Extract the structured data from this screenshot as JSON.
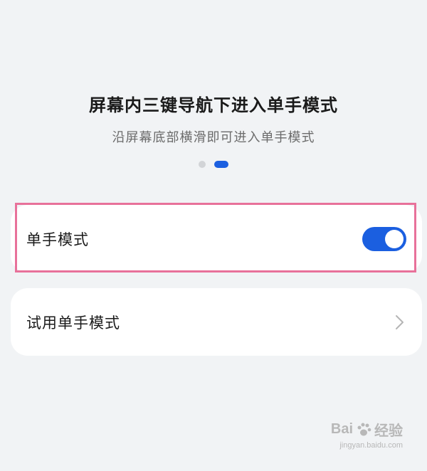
{
  "header": {
    "title": "屏幕内三键导航下进入单手模式",
    "subtitle": "沿屏幕底部横滑即可进入单手模式"
  },
  "pager": {
    "total": 2,
    "active_index": 1
  },
  "settings": {
    "one_hand_mode": {
      "label": "单手模式",
      "enabled": true
    },
    "try_one_hand_mode": {
      "label": "试用单手模式",
      "icon": "chevron-right-icon"
    }
  },
  "colors": {
    "accent": "#1b5fe0",
    "highlight_border": "#e8719a",
    "background": "#f1f3f5"
  },
  "watermark": {
    "brand": "Bai",
    "brand_suffix": "经验",
    "url": "jingyan.baidu.com"
  }
}
